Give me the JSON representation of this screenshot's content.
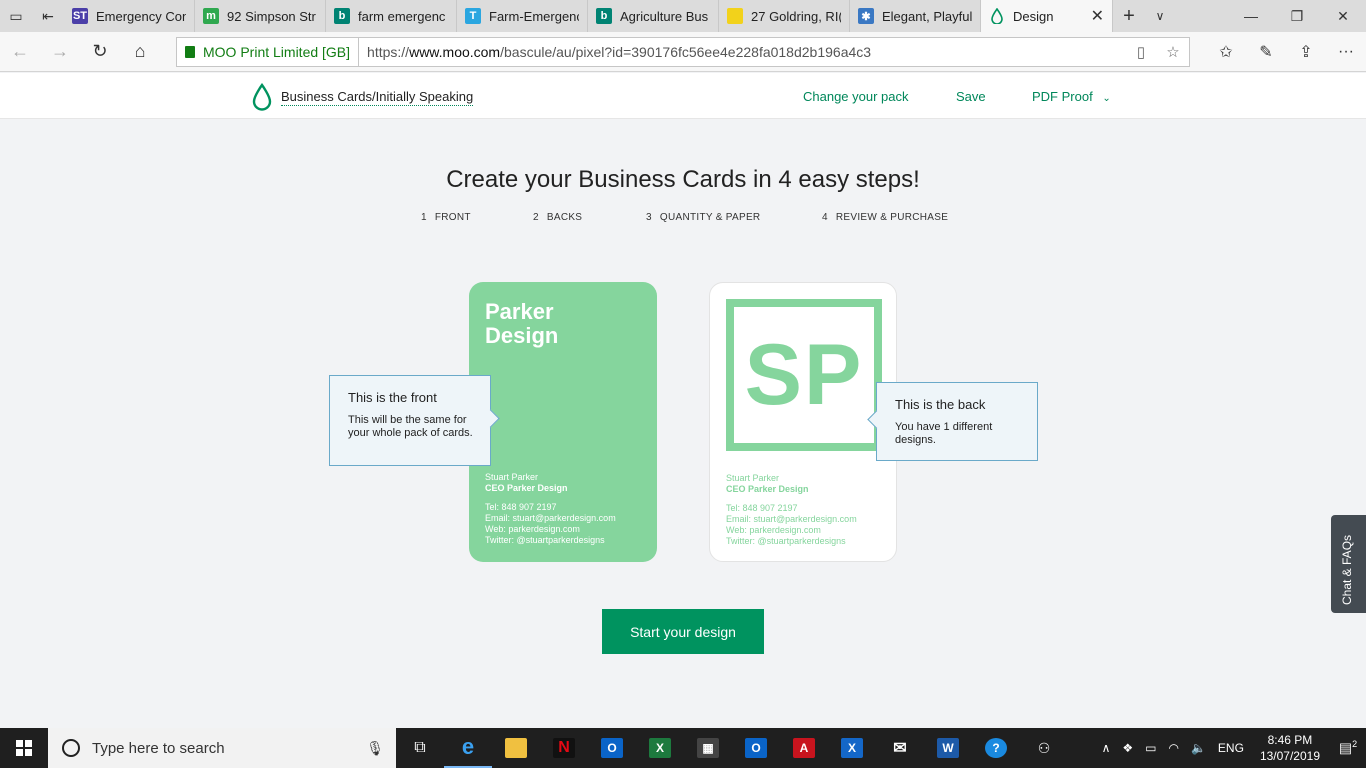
{
  "browser": {
    "tabs": [
      {
        "label": "Emergency Con",
        "icon": "st-icon",
        "color": "#4b3fa8",
        "glyph": "ST"
      },
      {
        "label": "92 Simpson Str",
        "icon": "m-icon",
        "color": "#2fa84f",
        "glyph": "m"
      },
      {
        "label": "farm emergenc",
        "icon": "bing-icon",
        "color": "#008373",
        "glyph": "b"
      },
      {
        "label": "Farm-Emergenc",
        "icon": "t-icon",
        "color": "#2aa6e0",
        "glyph": "T"
      },
      {
        "label": "Agriculture Bus",
        "icon": "bing-icon",
        "color": "#008373",
        "glyph": "b"
      },
      {
        "label": "27 Goldring, RI(",
        "icon": "yellow-icon",
        "color": "#f2d21b",
        "glyph": ""
      },
      {
        "label": "Elegant, Playful,",
        "icon": "sparkle-icon",
        "color": "#3a78c3",
        "glyph": "✱"
      }
    ],
    "active_tab": {
      "label": "Design"
    },
    "site_identity": "MOO Print Limited [GB]",
    "url_prefix": "https://",
    "url_host": "www.moo.com",
    "url_path": "/bascule/au/pixel?id=390176fc56ee4e228fa018d2b196a4c3"
  },
  "header": {
    "breadcrumb": "Business Cards/Initially Speaking",
    "change_pack": "Change your pack",
    "save": "Save",
    "pdf_proof": "PDF Proof",
    "accent": "#00875a"
  },
  "main": {
    "title": "Create your Business Cards in 4 easy steps!",
    "steps": [
      {
        "num": "1",
        "label": "FRONT"
      },
      {
        "num": "2",
        "label": "BACKS"
      },
      {
        "num": "3",
        "label": "QUANTITY & PAPER"
      },
      {
        "num": "4",
        "label": "REVIEW & PURCHASE"
      }
    ],
    "front_card": {
      "title_line1": "Parker",
      "title_line2": "Design",
      "name": "Stuart Parker",
      "role": "CEO Parker Design",
      "tel": "Tel: 848 907 2197",
      "email": "Email: stuart@parkerdesign.com",
      "web": "Web: parkerdesign.com",
      "twitter": "Twitter: @stuartparkerdesigns"
    },
    "back_card": {
      "monogram": "SP",
      "name": "Stuart Parker",
      "role": "CEO Parker Design",
      "tel": "Tel: 848 907 2197",
      "email": "Email: stuart@parkerdesign.com",
      "web": "Web: parkerdesign.com",
      "twitter": "Twitter: @stuartparkerdesigns"
    },
    "tip_front": {
      "heading": "This is the front",
      "body": "This will be the same for your whole pack of cards."
    },
    "tip_back": {
      "heading": "This is the back",
      "body": "You have 1 different designs."
    },
    "cta": "Start your design",
    "chat": "Chat & FAQs"
  },
  "taskbar": {
    "search_placeholder": "Type here to search",
    "language": "ENG",
    "time": "8:46 PM",
    "date": "13/07/2019",
    "notifications": "2"
  }
}
